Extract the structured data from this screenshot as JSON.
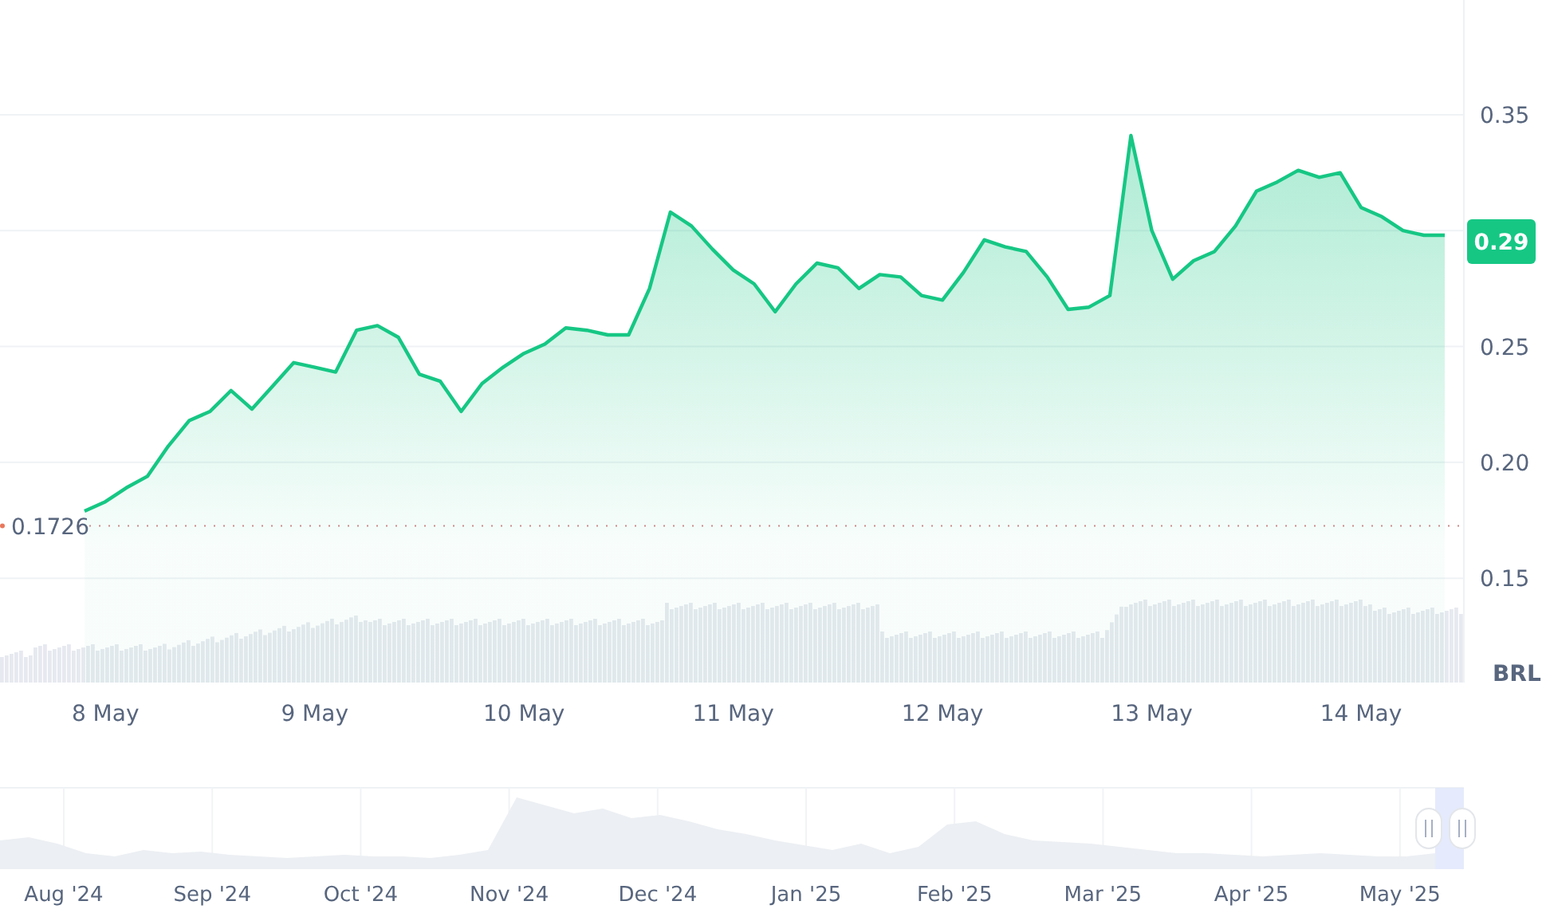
{
  "chart": {
    "chart_data": {
      "type": "area",
      "categories": [
        null,
        "8 May",
        null,
        null,
        null,
        null,
        null,
        null,
        null,
        null,
        null,
        "9 May",
        null,
        null,
        null,
        null,
        null,
        null,
        null,
        null,
        null,
        "10 May",
        null,
        null,
        null,
        null,
        null,
        null,
        null,
        null,
        null,
        "11 May",
        null,
        null,
        null,
        null,
        null,
        null,
        null,
        null,
        null,
        "12 May",
        null,
        null,
        null,
        null,
        null,
        null,
        null,
        null,
        null,
        "13 May",
        null,
        null,
        null,
        null,
        null,
        null,
        null,
        null,
        null,
        "14 May",
        null,
        null,
        null,
        null
      ],
      "series": [
        {
          "color": "#16c784",
          "values": [
            0.179,
            0.183,
            0.189,
            0.194,
            0.207,
            0.218,
            0.222,
            0.231,
            0.223,
            0.233,
            0.243,
            0.241,
            0.239,
            0.257,
            0.259,
            0.254,
            0.238,
            0.235,
            0.222,
            0.234,
            0.241,
            0.247,
            0.251,
            0.258,
            0.257,
            0.255,
            0.255,
            0.275,
            0.308,
            0.302,
            0.292,
            0.283,
            0.277,
            0.265,
            0.277,
            0.286,
            0.284,
            0.275,
            0.281,
            0.28,
            0.272,
            0.27,
            0.282,
            0.296,
            0.293,
            0.291,
            0.28,
            0.266,
            0.267,
            0.272,
            0.341,
            0.3,
            0.279,
            0.287,
            0.291,
            0.302,
            0.317,
            0.321,
            0.326,
            0.323,
            0.325,
            0.31,
            0.306,
            0.3,
            0.298,
            0.298
          ]
        }
      ],
      "grid": true,
      "ylim": [
        0.105,
        0.3995
      ],
      "yticks": [
        {
          "value": 0.15,
          "label": "0.15"
        },
        {
          "value": 0.2,
          "label": "0.20"
        },
        {
          "value": 0.25,
          "label": "0.25"
        },
        {
          "value": 0.35,
          "label": "0.35"
        }
      ],
      "ref_lines": [
        {
          "axis": "y",
          "value": 0.1726,
          "label": "0.1726"
        }
      ],
      "annotations": [
        "0.29"
      ]
    },
    "currency": "BRL"
  },
  "navigator": {
    "labels": [
      "Aug '24",
      "Sep '24",
      "Oct '24",
      "Nov '24",
      "Dec '24",
      "Jan '25",
      "Feb '25",
      "Mar '25",
      "Apr '25",
      "May '25"
    ]
  }
}
